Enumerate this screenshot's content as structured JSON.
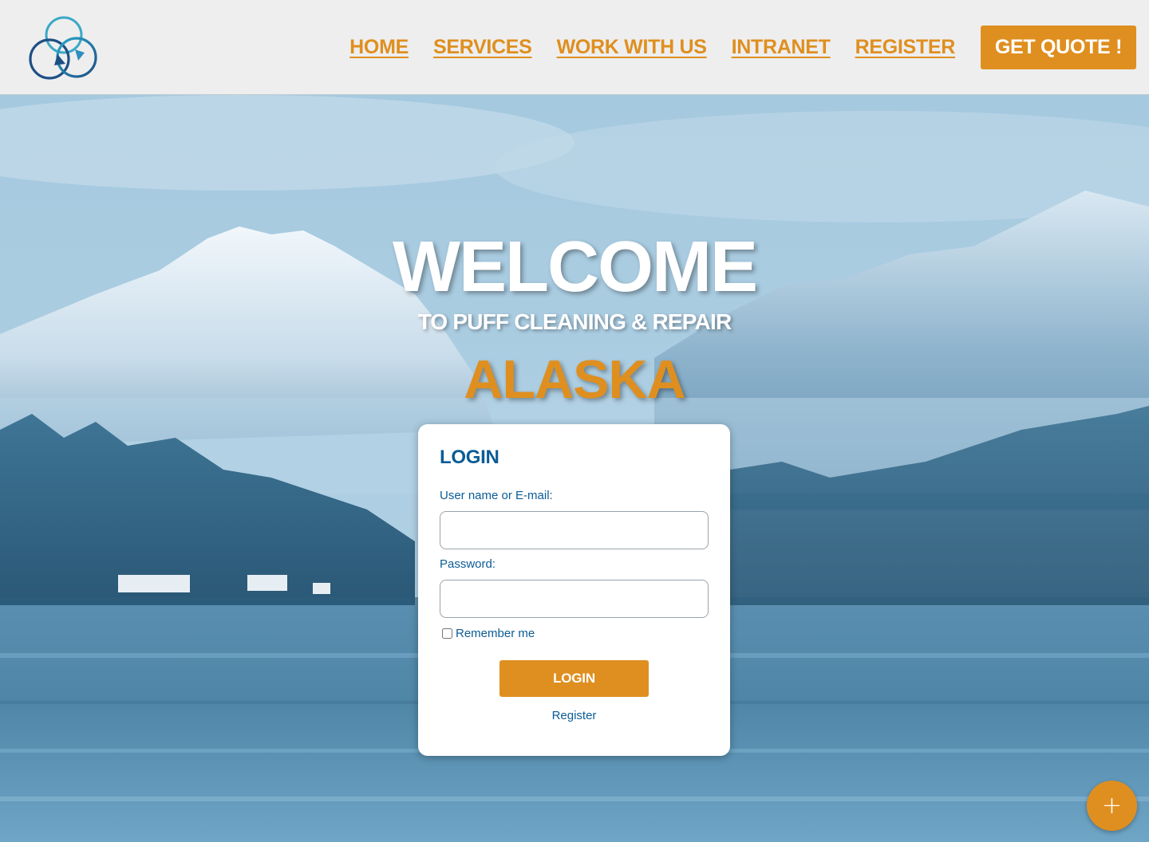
{
  "header": {
    "logo_icon": "recycle-arrows-logo",
    "nav": [
      {
        "label": "HOME"
      },
      {
        "label": "SERVICES"
      },
      {
        "label": "WORK WITH US"
      },
      {
        "label": "INTRANET"
      },
      {
        "label": "REGISTER"
      }
    ],
    "quote_button": "GET QUOTE !"
  },
  "hero": {
    "welcome": "WELCOME",
    "subtitle": "TO PUFF CLEANING & REPAIR",
    "location": "ALASKA"
  },
  "login": {
    "title": "LOGIN",
    "username_label": "User name or E-mail:",
    "username_value": "",
    "password_label": "Password:",
    "password_value": "",
    "remember_label": "Remember me",
    "remember_checked": false,
    "submit_label": "LOGIN",
    "register_link": "Register"
  },
  "fab": {
    "icon": "plus-icon",
    "glyph": "+"
  },
  "colors": {
    "accent": "#df8f1f",
    "primary_text": "#0b5c96",
    "header_bg": "#eeeeee"
  }
}
